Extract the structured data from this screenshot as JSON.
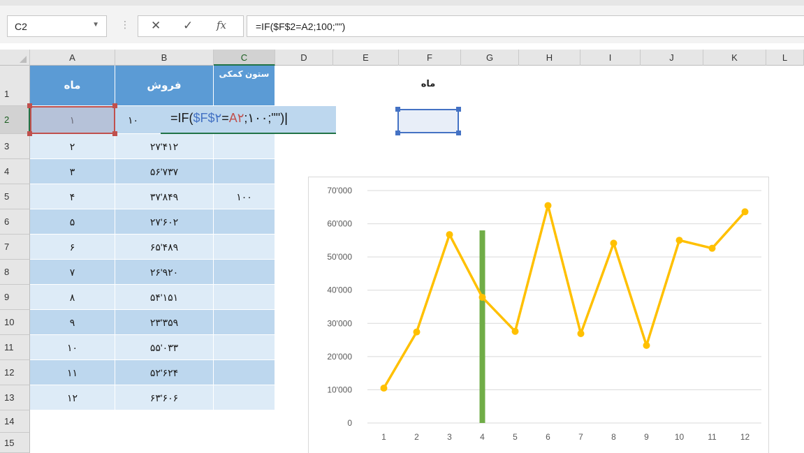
{
  "formula_bar": {
    "name_box": "C2",
    "dropdown_icon": "chevron-down-icon",
    "formula": "=IF($F$2=A2;100;\"\")",
    "cancel_icon": "✕",
    "enter_icon": "✓",
    "fx_icon": "fx"
  },
  "columns": [
    "A",
    "B",
    "C",
    "D",
    "E",
    "F",
    "G",
    "H",
    "I",
    "J",
    "K",
    "L"
  ],
  "rows": [
    "1",
    "2",
    "3",
    "4",
    "5",
    "6",
    "7",
    "8",
    "9",
    "10",
    "11",
    "12",
    "13",
    "14",
    "15"
  ],
  "table": {
    "headers": {
      "a": "ماه",
      "b": "فروش",
      "c": "ستون کمکی"
    },
    "data": [
      {
        "a": "۱",
        "b": "۱۰"
      },
      {
        "a": "۲",
        "b": "۲۷'۴۱۲"
      },
      {
        "a": "۳",
        "b": "۵۶'۷۳۷"
      },
      {
        "a": "۴",
        "b": "۳۷'۸۴۹",
        "c": "۱۰۰"
      },
      {
        "a": "۵",
        "b": "۲۷'۶۰۲"
      },
      {
        "a": "۶",
        "b": "۶۵'۴۸۹"
      },
      {
        "a": "۷",
        "b": "۲۶'۹۲۰"
      },
      {
        "a": "۸",
        "b": "۵۴'۱۵۱"
      },
      {
        "a": "۹",
        "b": "۲۳'۳۵۹"
      },
      {
        "a": "۱۰",
        "b": "۵۵'۰۳۳"
      },
      {
        "a": "۱۱",
        "b": "۵۲'۶۲۴"
      },
      {
        "a": "۱۲",
        "b": "۶۳'۶۰۶"
      }
    ]
  },
  "editing": {
    "prefix": "=IF(",
    "ref1": "$F$۲",
    "eq": "=",
    "ref2": "A۲",
    "rest": ";۱۰۰;\"\")"
  },
  "f1_label": "ماه",
  "chart_data": {
    "type": "line",
    "categories": [
      "1",
      "2",
      "3",
      "4",
      "5",
      "6",
      "7",
      "8",
      "9",
      "10",
      "11",
      "12"
    ],
    "series": [
      {
        "values": [
          10500,
          27412,
          56737,
          37849,
          27602,
          65489,
          26920,
          54151,
          23359,
          55033,
          52624,
          63606
        ],
        "color": "#ffc000"
      },
      {
        "type": "bar",
        "values": [
          null,
          null,
          null,
          58000,
          null,
          null,
          null,
          null,
          null,
          null,
          null,
          null
        ],
        "color": "#70ad47"
      }
    ],
    "yticks": [
      "0",
      "10'000",
      "20'000",
      "30'000",
      "40'000",
      "50'000",
      "60'000",
      "70'000"
    ],
    "ylim": [
      0,
      70000
    ],
    "grid": true
  }
}
